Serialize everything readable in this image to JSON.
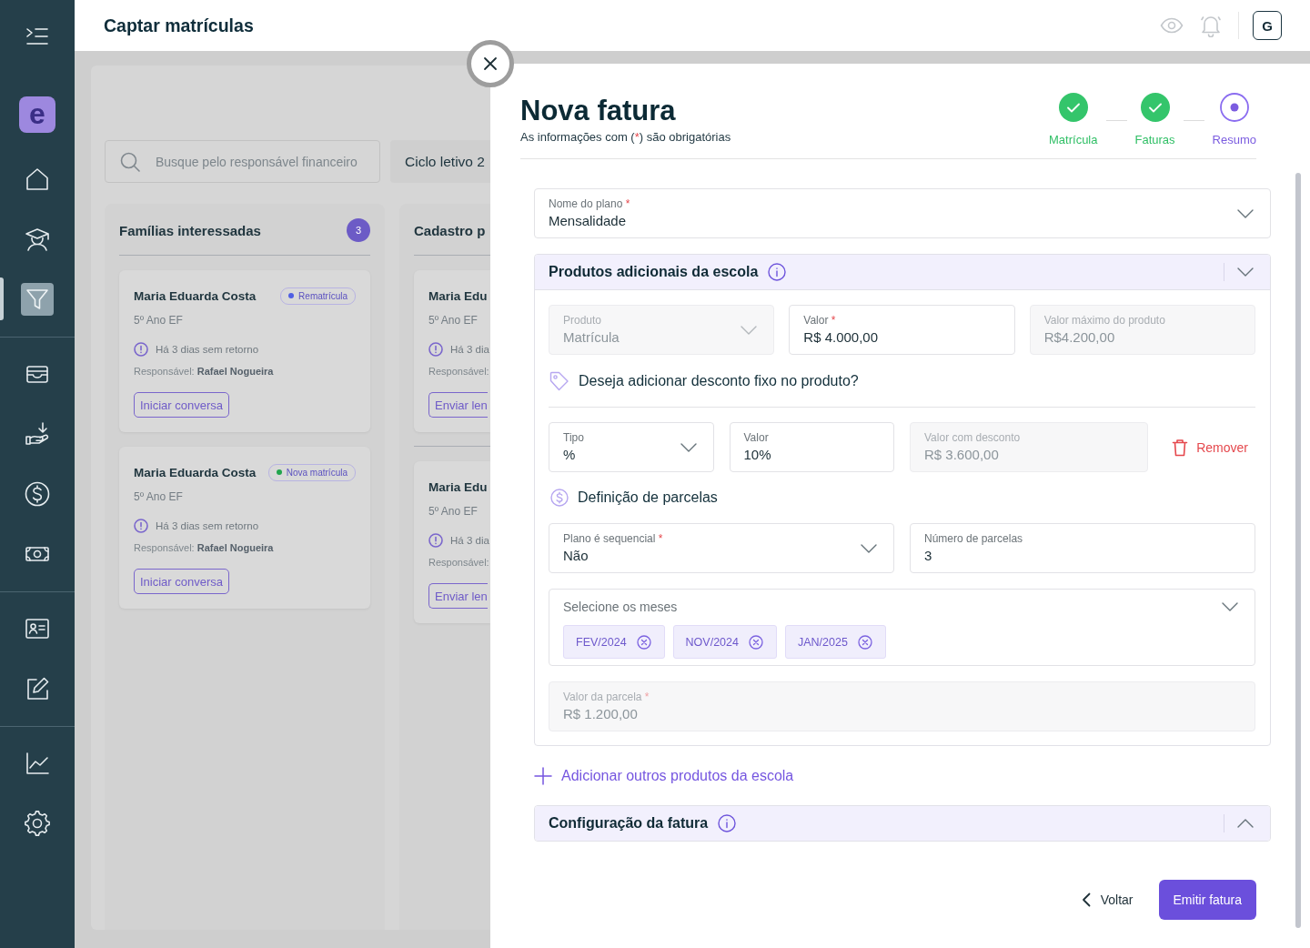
{
  "sidebar": {
    "logo": "e",
    "groups": [
      {
        "items": [
          {
            "kind": "home",
            "selected": false
          },
          {
            "kind": "student",
            "selected": false
          },
          {
            "kind": "filter",
            "selected": true
          }
        ]
      },
      {
        "items": [
          {
            "kind": "wallet",
            "selected": false
          },
          {
            "kind": "receive",
            "selected": false
          },
          {
            "kind": "dollar",
            "selected": false
          },
          {
            "kind": "cash",
            "selected": false
          }
        ]
      },
      {
        "items": [
          {
            "kind": "contact",
            "selected": false
          },
          {
            "kind": "edit",
            "selected": false
          }
        ]
      },
      {
        "items": [
          {
            "kind": "chart",
            "selected": false
          },
          {
            "kind": "settings",
            "selected": false
          }
        ]
      }
    ]
  },
  "header": {
    "title": "Captar matrículas",
    "avatar": "G"
  },
  "board": {
    "search": {
      "placeholder": "Busque pelo responsável financeiro"
    },
    "cycle_filter": "Ciclo letivo 2",
    "columns": [
      {
        "title": "Famílias interessadas",
        "count": "3",
        "groups": [
          {
            "cards": [
              {
                "name": "Maria Eduarda Costa",
                "tag": {
                  "label": "Rematrícula",
                  "color": "#4f5fe3"
                },
                "grade": "5º Ano EF",
                "alert": "Há 3 dias sem retorno",
                "responsible": "Responsável: **Rafael Nogueira**",
                "action": "Iniciar conversa"
              },
              {
                "name": "Maria Eduarda Costa",
                "tag": {
                  "label": "Nova matrícula",
                  "color": "#22a54d"
                },
                "grade": "5º Ano EF",
                "alert": "Há 3 dias sem retorno",
                "responsible": "Responsável: **Rafael Nogueira**",
                "action": "Iniciar conversa"
              }
            ]
          }
        ]
      },
      {
        "title": "Cadastro p",
        "groups": [
          {
            "cards": [
              {
                "name": "Maria Edu",
                "grade": "5º Ano EF",
                "alert": "Há 3 dia",
                "responsible": "Responsável:",
                "action": "Enviar len"
              }
            ]
          },
          {
            "cards": [
              {
                "name": "Maria Edu",
                "grade": "5º Ano EF",
                "alert": "Há 3 dia",
                "responsible": "Responsável:",
                "action": "Enviar len"
              }
            ]
          }
        ]
      }
    ]
  },
  "drawer": {
    "title": "Nova fatura",
    "required_note": {
      "before": "As informações com (",
      "mark": "*",
      "after": ") são obrigatórias"
    },
    "steps": [
      {
        "label": "Matrícula",
        "done": true,
        "selected": false
      },
      {
        "label": "Faturas",
        "done": true,
        "selected": false
      },
      {
        "label": "Resumo",
        "done": false,
        "selected": true
      }
    ],
    "plan_field": {
      "kind": "select",
      "label": "Nome do plano",
      "required_mark": "*",
      "value": "Mensalidade",
      "disabled": false
    },
    "products_section": {
      "title": "Produtos adicionais da escola",
      "expanded": true,
      "product_fields": [
        {
          "kind": "select",
          "label": "Produto",
          "value": "Matrícula",
          "disabled": true
        },
        {
          "kind": "text",
          "label": "Valor",
          "required_mark": "*",
          "value": "R$ 4.000,00",
          "disabled": false
        },
        {
          "kind": "text",
          "label": "Valor máximo do produto",
          "value": "R$4.200,00",
          "disabled": true
        }
      ],
      "discount_question": "Deseja adicionar desconto fixo no produto?",
      "discount_fields": [
        {
          "kind": "select",
          "label": "Tipo",
          "value": "%",
          "disabled": false
        },
        {
          "kind": "text",
          "label": "Valor",
          "value": "10%",
          "disabled": false
        },
        {
          "kind": "text",
          "label": "Valor com desconto",
          "value": "R$ 3.600,00",
          "disabled": true
        }
      ],
      "remove_button": "Remover",
      "installments_title": "Definição de parcelas",
      "installment_fields": [
        {
          "kind": "select",
          "label": "Plano é sequencial",
          "required_mark": "*",
          "value": "Não",
          "disabled": false
        },
        {
          "kind": "text",
          "label": "Número de parcelas",
          "value": "3",
          "disabled": false
        }
      ],
      "months_field": {
        "label": "Selecione os meses",
        "chips": [
          "FEV/2024",
          "NOV/2024",
          "JAN/2025"
        ]
      },
      "installment_value_field": {
        "kind": "text",
        "label": "Valor da parcela",
        "required_mark": "*",
        "value": "R$ 1.200,00",
        "disabled": true
      }
    },
    "add_product_link": "Adicionar outros produtos da escola",
    "invoice_section": {
      "title": "Configuração da fatura",
      "expanded": false
    },
    "back_button": "Voltar",
    "submit_button": "Emitir fatura"
  }
}
